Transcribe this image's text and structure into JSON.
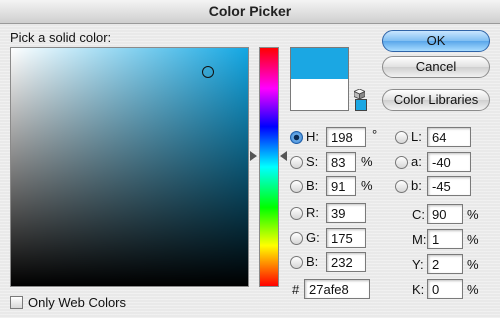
{
  "window": {
    "title": "Color Picker"
  },
  "picker": {
    "label": "Pick a solid color:",
    "only_web_colors_label": "Only Web Colors"
  },
  "swatches": {
    "new_color": "#1ba7e3",
    "current_color": "#ffffff"
  },
  "buttons": {
    "ok": "OK",
    "cancel": "Cancel",
    "color_libraries": "Color Libraries"
  },
  "hsb": {
    "h": {
      "label": "H:",
      "value": "198",
      "unit": "°"
    },
    "s": {
      "label": "S:",
      "value": "83",
      "unit": "%"
    },
    "b": {
      "label": "B:",
      "value": "91",
      "unit": "%"
    }
  },
  "rgb": {
    "r": {
      "label": "R:",
      "value": "39"
    },
    "g": {
      "label": "G:",
      "value": "175"
    },
    "b": {
      "label": "B:",
      "value": "232"
    }
  },
  "lab": {
    "l": {
      "label": "L:",
      "value": "64"
    },
    "a": {
      "label": "a:",
      "value": "-40"
    },
    "b": {
      "label": "b:",
      "value": "-45"
    }
  },
  "cmyk": {
    "c": {
      "label": "C:",
      "value": "90",
      "unit": "%"
    },
    "m": {
      "label": "M:",
      "value": "1",
      "unit": "%"
    },
    "y": {
      "label": "Y:",
      "value": "2",
      "unit": "%"
    },
    "k": {
      "label": "K:",
      "value": "0",
      "unit": "%"
    }
  },
  "hex": {
    "label": "#",
    "value": "27afe8"
  }
}
